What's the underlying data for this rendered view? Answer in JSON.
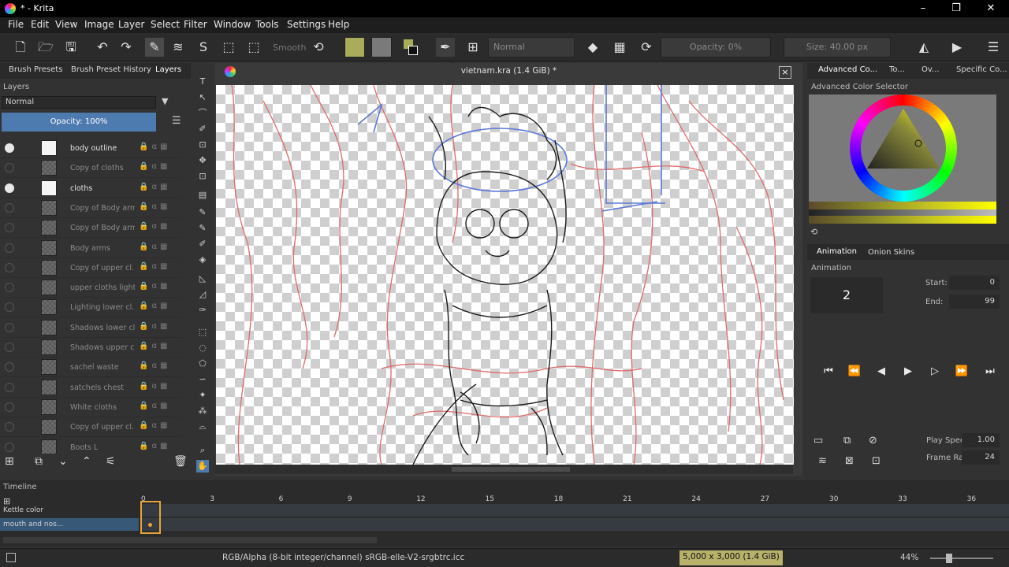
{
  "window": {
    "title": "* - Krita"
  },
  "menu": [
    "File",
    "Edit",
    "View",
    "Image",
    "Layer",
    "Select",
    "Filter",
    "Window",
    "Tools",
    "Settings",
    "Help"
  ],
  "toolbar": {
    "smooth_label": "Smooth",
    "blend_mode": "Normal",
    "opacity": "Opacity: 0%",
    "size": "Size: 40.00 px",
    "fg_color": "#a9ad5a",
    "bg_color": "#7a7a7a"
  },
  "left_panel": {
    "tabs": [
      "Brush Presets",
      "Brush Preset History",
      "Layers"
    ],
    "title": "Layers",
    "blend_mode": "Normal",
    "opacity": "Opacity:  100%",
    "layers": [
      {
        "name": "body outline",
        "visible": true,
        "thumb": "white"
      },
      {
        "name": "Copy of cloths",
        "visible": false,
        "thumb": "check"
      },
      {
        "name": "cloths",
        "visible": true,
        "thumb": "white"
      },
      {
        "name": "Copy of Body arms",
        "visible": false,
        "thumb": "check"
      },
      {
        "name": "Copy of Body arms",
        "visible": false,
        "thumb": "check"
      },
      {
        "name": "Body arms",
        "visible": false,
        "thumb": "check"
      },
      {
        "name": "Copy of upper cl...",
        "visible": false,
        "thumb": "check"
      },
      {
        "name": "upper cloths light...",
        "visible": false,
        "thumb": "check"
      },
      {
        "name": "Lighting lower cl...",
        "visible": false,
        "thumb": "check"
      },
      {
        "name": "Shadows lower cl...",
        "visible": false,
        "thumb": "check"
      },
      {
        "name": "Shadows upper c...",
        "visible": false,
        "thumb": "check"
      },
      {
        "name": "sachel waste",
        "visible": false,
        "thumb": "check"
      },
      {
        "name": "satchels chest",
        "visible": false,
        "thumb": "check"
      },
      {
        "name": "White cloths",
        "visible": false,
        "thumb": "check"
      },
      {
        "name": "Copy of upper cl...",
        "visible": false,
        "thumb": "check"
      },
      {
        "name": "Boots L",
        "visible": false,
        "thumb": "check"
      }
    ]
  },
  "document": {
    "title": "vietnam.kra (1.4 GiB) *",
    "close": "×"
  },
  "right_panel": {
    "tabs": [
      "Advanced Co...",
      "To...",
      "Ov...",
      "Specific Co..."
    ],
    "color_selector_title": "Advanced Color Selector",
    "anim_tabs": [
      "Animation",
      "Onion Skins"
    ],
    "anim_title": "Animation",
    "current_frame": "2",
    "start_label": "Start:",
    "start_value": "0",
    "end_label": "End:",
    "end_value": "99",
    "play_speed_label": "Play Speed:",
    "play_speed_value": "1.00",
    "frame_rate_label": "Frame Rate:",
    "frame_rate_value": "24"
  },
  "timeline": {
    "title": "Timeline",
    "frame_numbers": [
      "0",
      "3",
      "6",
      "9",
      "12",
      "15",
      "18",
      "21",
      "24",
      "27",
      "30",
      "33",
      "36"
    ],
    "rows": [
      "Kettle color",
      "mouth and nos..."
    ]
  },
  "status": {
    "color_info": "RGB/Alpha (8-bit integer/channel)  sRGB-elle-V2-srgbtrc.icc",
    "dimensions": "5,000 x 3,000 (1.4 GiB)",
    "zoom": "44%"
  }
}
